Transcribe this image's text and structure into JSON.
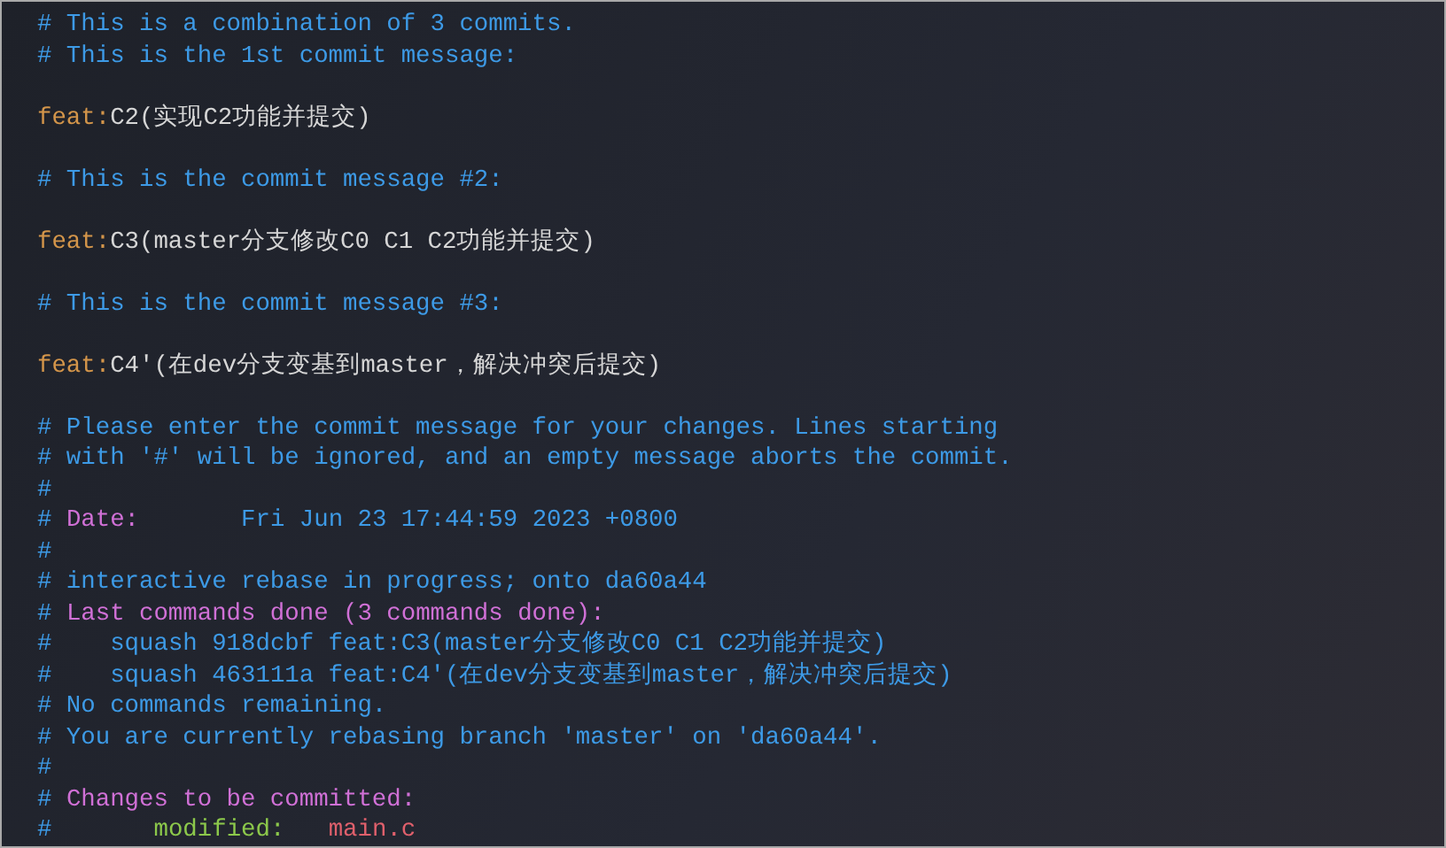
{
  "editor": {
    "lines": [
      {
        "kind": "text",
        "segments": [
          {
            "kind": "comment",
            "text": "# This is a combination of 3 commits."
          }
        ]
      },
      {
        "kind": "text",
        "segments": [
          {
            "kind": "comment",
            "text": "# This is the 1st commit message:"
          }
        ]
      },
      {
        "kind": "blank"
      },
      {
        "kind": "text",
        "segments": [
          {
            "kind": "keyword",
            "text": "feat:"
          },
          {
            "kind": "message",
            "text": "C2(实现C2功能并提交)"
          }
        ]
      },
      {
        "kind": "blank"
      },
      {
        "kind": "text",
        "segments": [
          {
            "kind": "comment",
            "text": "# This is the commit message #2:"
          }
        ]
      },
      {
        "kind": "blank"
      },
      {
        "kind": "text",
        "segments": [
          {
            "kind": "keyword",
            "text": "feat:"
          },
          {
            "kind": "message",
            "text": "C3(master分支修改C0 C1 C2功能并提交)"
          }
        ]
      },
      {
        "kind": "blank"
      },
      {
        "kind": "text",
        "segments": [
          {
            "kind": "comment",
            "text": "# This is the commit message #3:"
          }
        ]
      },
      {
        "kind": "blank"
      },
      {
        "kind": "text",
        "segments": [
          {
            "kind": "keyword",
            "text": "feat:"
          },
          {
            "kind": "message",
            "text": "C4'(在dev分支变基到master，解决冲突后提交)"
          }
        ]
      },
      {
        "kind": "blank"
      },
      {
        "kind": "text",
        "segments": [
          {
            "kind": "comment",
            "text": "# Please enter the commit message for your changes. Lines starting"
          }
        ]
      },
      {
        "kind": "text",
        "segments": [
          {
            "kind": "comment",
            "text": "# with '#' will be ignored, and an empty message aborts the commit."
          }
        ]
      },
      {
        "kind": "text",
        "segments": [
          {
            "kind": "comment",
            "text": "#"
          }
        ]
      },
      {
        "kind": "text",
        "segments": [
          {
            "kind": "comment",
            "text": "#"
          },
          {
            "kind": "heading",
            "text": "Date:"
          },
          {
            "kind": "date",
            "text": "Fri Jun 23 17:44:59 2023 +0800"
          }
        ]
      },
      {
        "kind": "text",
        "segments": [
          {
            "kind": "comment",
            "text": "#"
          }
        ]
      },
      {
        "kind": "text",
        "segments": [
          {
            "kind": "comment",
            "text": "# interactive rebase in progress; onto da60a44"
          }
        ]
      },
      {
        "kind": "text",
        "segments": [
          {
            "kind": "comment",
            "text": "#"
          },
          {
            "kind": "heading",
            "text": "Last commands done (3 commands done):"
          }
        ]
      },
      {
        "kind": "text",
        "segments": [
          {
            "kind": "comment",
            "text": "#"
          },
          {
            "kind": "indented",
            "text": "squash 918dcbf feat:C3(master分支修改C0 C1 C2功能并提交)"
          }
        ]
      },
      {
        "kind": "text",
        "segments": [
          {
            "kind": "comment",
            "text": "#"
          },
          {
            "kind": "indented",
            "text": "squash 463111a feat:C4'(在dev分支变基到master，解决冲突后提交)"
          }
        ]
      },
      {
        "kind": "text",
        "segments": [
          {
            "kind": "comment",
            "text": "# No commands remaining."
          }
        ]
      },
      {
        "kind": "text",
        "segments": [
          {
            "kind": "comment",
            "text": "# You are currently rebasing branch 'master' on 'da60a44'."
          }
        ]
      },
      {
        "kind": "text",
        "segments": [
          {
            "kind": "comment",
            "text": "#"
          }
        ]
      },
      {
        "kind": "text",
        "segments": [
          {
            "kind": "comment",
            "text": "#"
          },
          {
            "kind": "heading",
            "text": "Changes to be committed:"
          }
        ]
      },
      {
        "kind": "text",
        "segments": [
          {
            "kind": "comment",
            "text": "#"
          },
          {
            "kind": "status",
            "text": "modified:"
          },
          {
            "kind": "file",
            "text": "main.c"
          }
        ]
      }
    ]
  }
}
